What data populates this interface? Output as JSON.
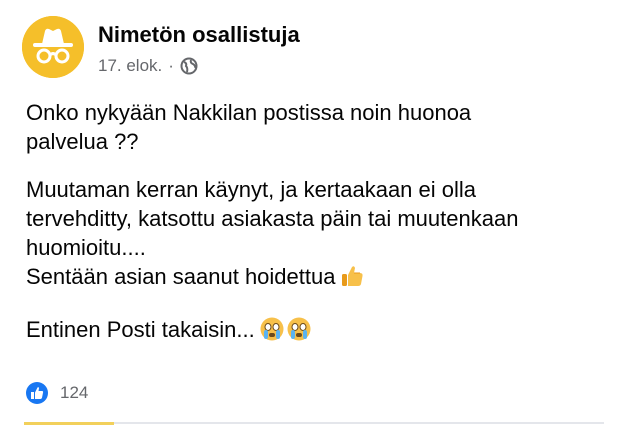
{
  "post": {
    "author": "Nimetön osallistuja",
    "date": "17. elok.",
    "separator": "·",
    "avatar_icon": "anonymous-incognito-icon",
    "privacy_icon": "globe-icon",
    "paragraphs": [
      {
        "lines": [
          "Onko nykyään Nakkilan postissa noin huonoa",
          "palvelua ??"
        ]
      },
      {
        "lines": [
          "Muutaman kerran käynyt, ja kertaakaan ei olla",
          "tervehditty, katsottu asiakasta päin tai muutenkaan",
          "huomioitu....",
          "Sentään asian saanut hoidettua"
        ],
        "emoji": "thumbs-up-emoji"
      },
      {
        "lines": [
          "Entinen Posti takaisin..."
        ],
        "emoji": "crying-face-emoji"
      }
    ],
    "reactions": {
      "icon": "like-icon",
      "count": "124"
    }
  },
  "colors": {
    "avatar_bg": "#f5bf2a",
    "like_blue": "#1877f2",
    "meta_gray": "#65676b",
    "text": "#050505"
  }
}
